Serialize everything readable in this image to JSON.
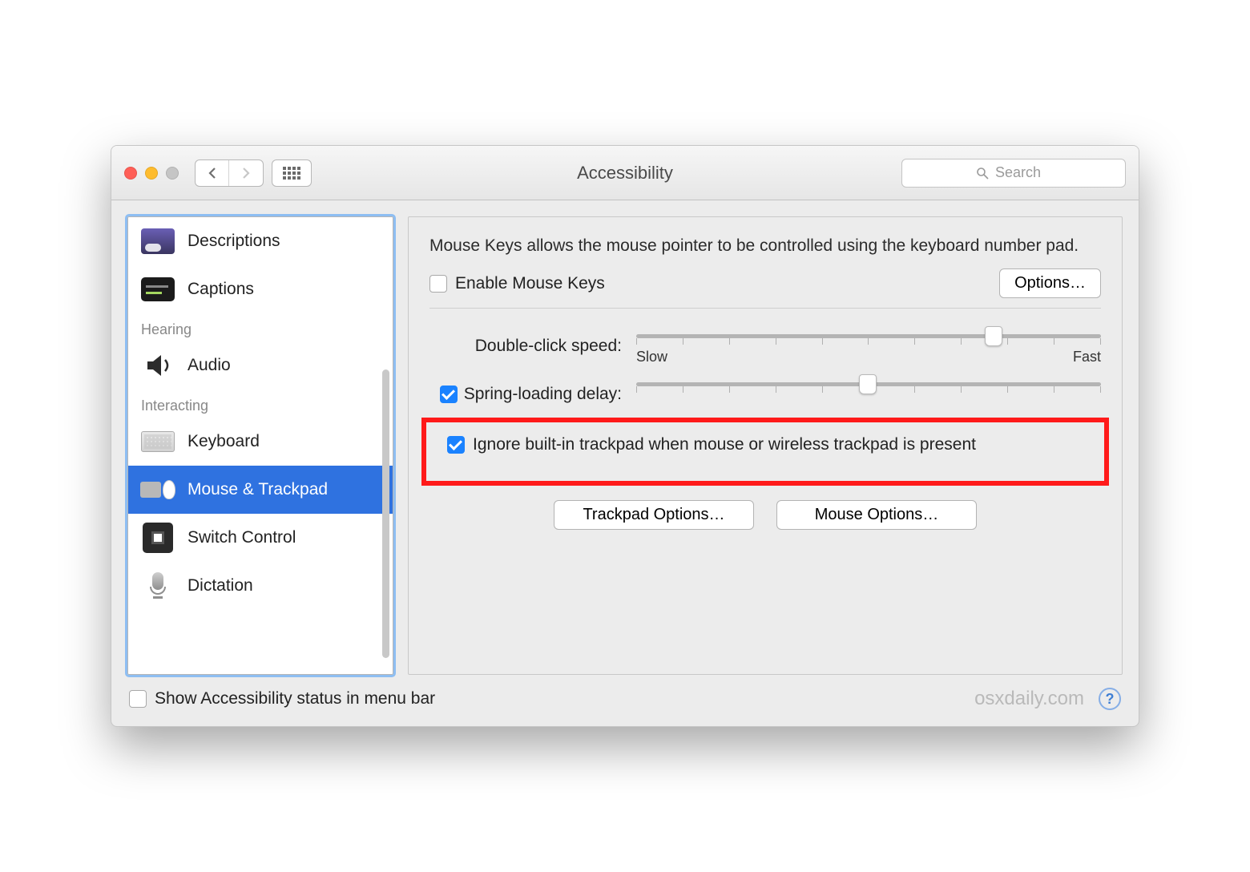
{
  "window": {
    "title": "Accessibility"
  },
  "search": {
    "placeholder": "Search"
  },
  "sidebar": {
    "items": [
      {
        "label": "Descriptions"
      },
      {
        "label": "Captions"
      }
    ],
    "section_hearing": "Hearing",
    "items_hearing": [
      {
        "label": "Audio"
      }
    ],
    "section_interacting": "Interacting",
    "items_interacting": [
      {
        "label": "Keyboard"
      },
      {
        "label": "Mouse & Trackpad"
      },
      {
        "label": "Switch Control"
      },
      {
        "label": "Dictation"
      }
    ]
  },
  "panel": {
    "mousekeys_desc": "Mouse Keys allows the mouse pointer to be controlled using the keyboard number pad.",
    "enable_mousekeys": "Enable Mouse Keys",
    "options_btn": "Options…",
    "dblclick_label": "Double-click speed:",
    "dblclick_slow": "Slow",
    "dblclick_fast": "Fast",
    "spring_label": "Spring-loading delay:",
    "ignore_label": "Ignore built-in trackpad when mouse or wireless trackpad is present",
    "trackpad_btn": "Trackpad Options…",
    "mouse_btn": "Mouse Options…"
  },
  "footer": {
    "show_status": "Show Accessibility status in menu bar",
    "watermark": "osxdaily.com"
  }
}
